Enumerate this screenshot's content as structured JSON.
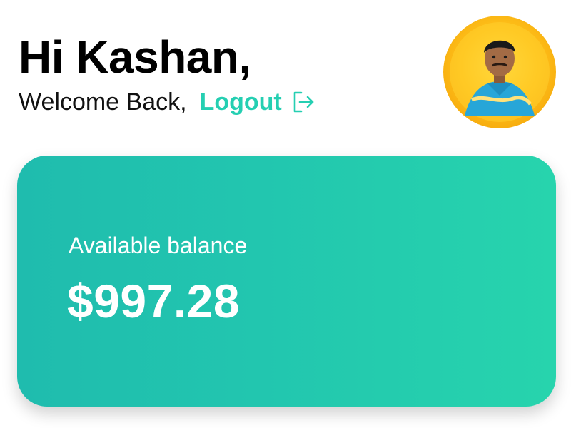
{
  "header": {
    "greeting": "Hi Kashan,",
    "welcome": "Welcome Back,",
    "logout_label": "Logout",
    "logout_icon": "logout-icon",
    "avatar_icon": "user-avatar"
  },
  "balance_card": {
    "label": "Available balance",
    "amount": "$997.28"
  },
  "colors": {
    "accent": "#25cfb2",
    "card_gradient_start": "#1fbcae",
    "card_gradient_end": "#27d4ad",
    "avatar_ring": "#ffc21a"
  }
}
